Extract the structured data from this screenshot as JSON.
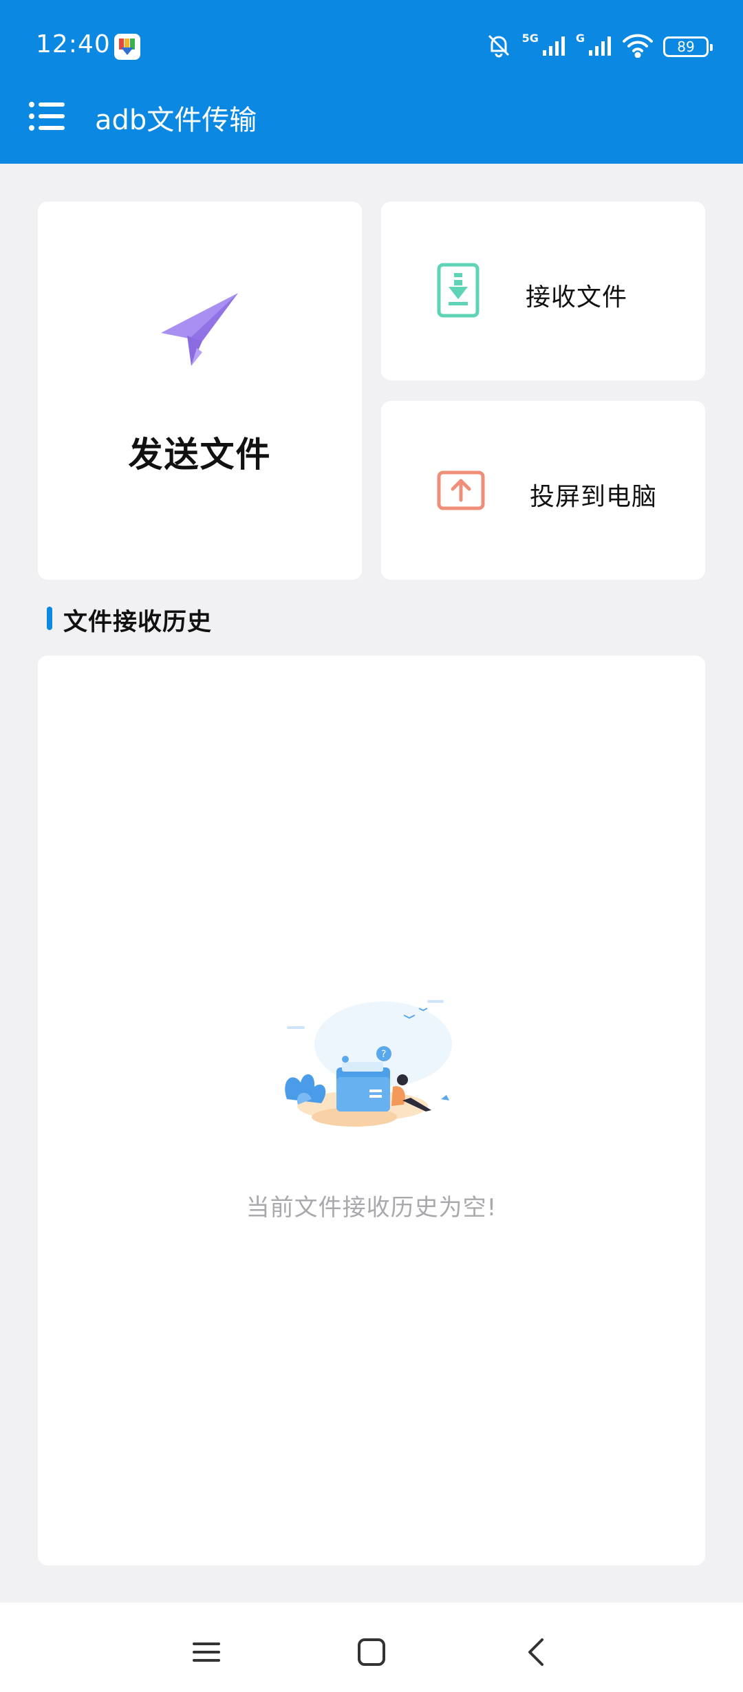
{
  "status_bar": {
    "time": "12:40",
    "signal_1_label": "5G",
    "signal_2_label": "G",
    "battery_level": "89",
    "icons": [
      "notification-app-icon",
      "bell-muted-icon",
      "signal-5g-icon",
      "signal-g-icon",
      "wifi-icon",
      "battery-icon"
    ]
  },
  "app_bar": {
    "title": "adb文件传输",
    "menu_icon": "menu-icon"
  },
  "actions": {
    "send": {
      "label": "发送文件",
      "icon": "paper-plane-icon",
      "color": "#a98ff2"
    },
    "receive": {
      "label": "接收文件",
      "icon": "download-file-icon",
      "color": "#5fd3b5"
    },
    "cast": {
      "label": "投屏到电脑",
      "icon": "upload-screen-icon",
      "color": "#ef8f7a"
    }
  },
  "history": {
    "title": "文件接收历史",
    "empty_text": "当前文件接收历史为空!",
    "empty_illustration": "empty-folder-illustration"
  },
  "nav_bar": {
    "icons": [
      "recents-icon",
      "home-icon",
      "back-icon"
    ]
  },
  "colors": {
    "primary": "#0a88e2",
    "background": "#f1f1f3"
  }
}
